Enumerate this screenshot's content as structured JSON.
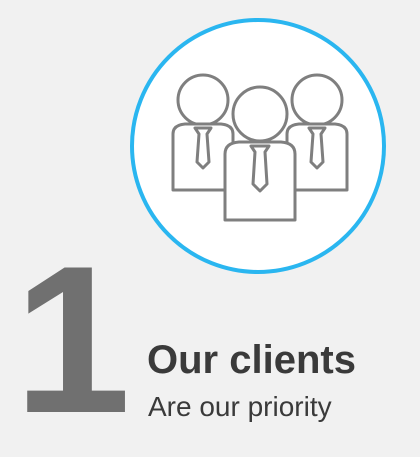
{
  "number": "1",
  "title": "Our clients",
  "subtitle": "Are our priority",
  "icon": "people-group-icon",
  "colors": {
    "background": "#f1f1f1",
    "circle_border": "#2ab6f0",
    "circle_fill": "#ffffff",
    "number": "#707070",
    "text": "#3a3a3a",
    "icon_stroke": "#7f7f7f"
  }
}
